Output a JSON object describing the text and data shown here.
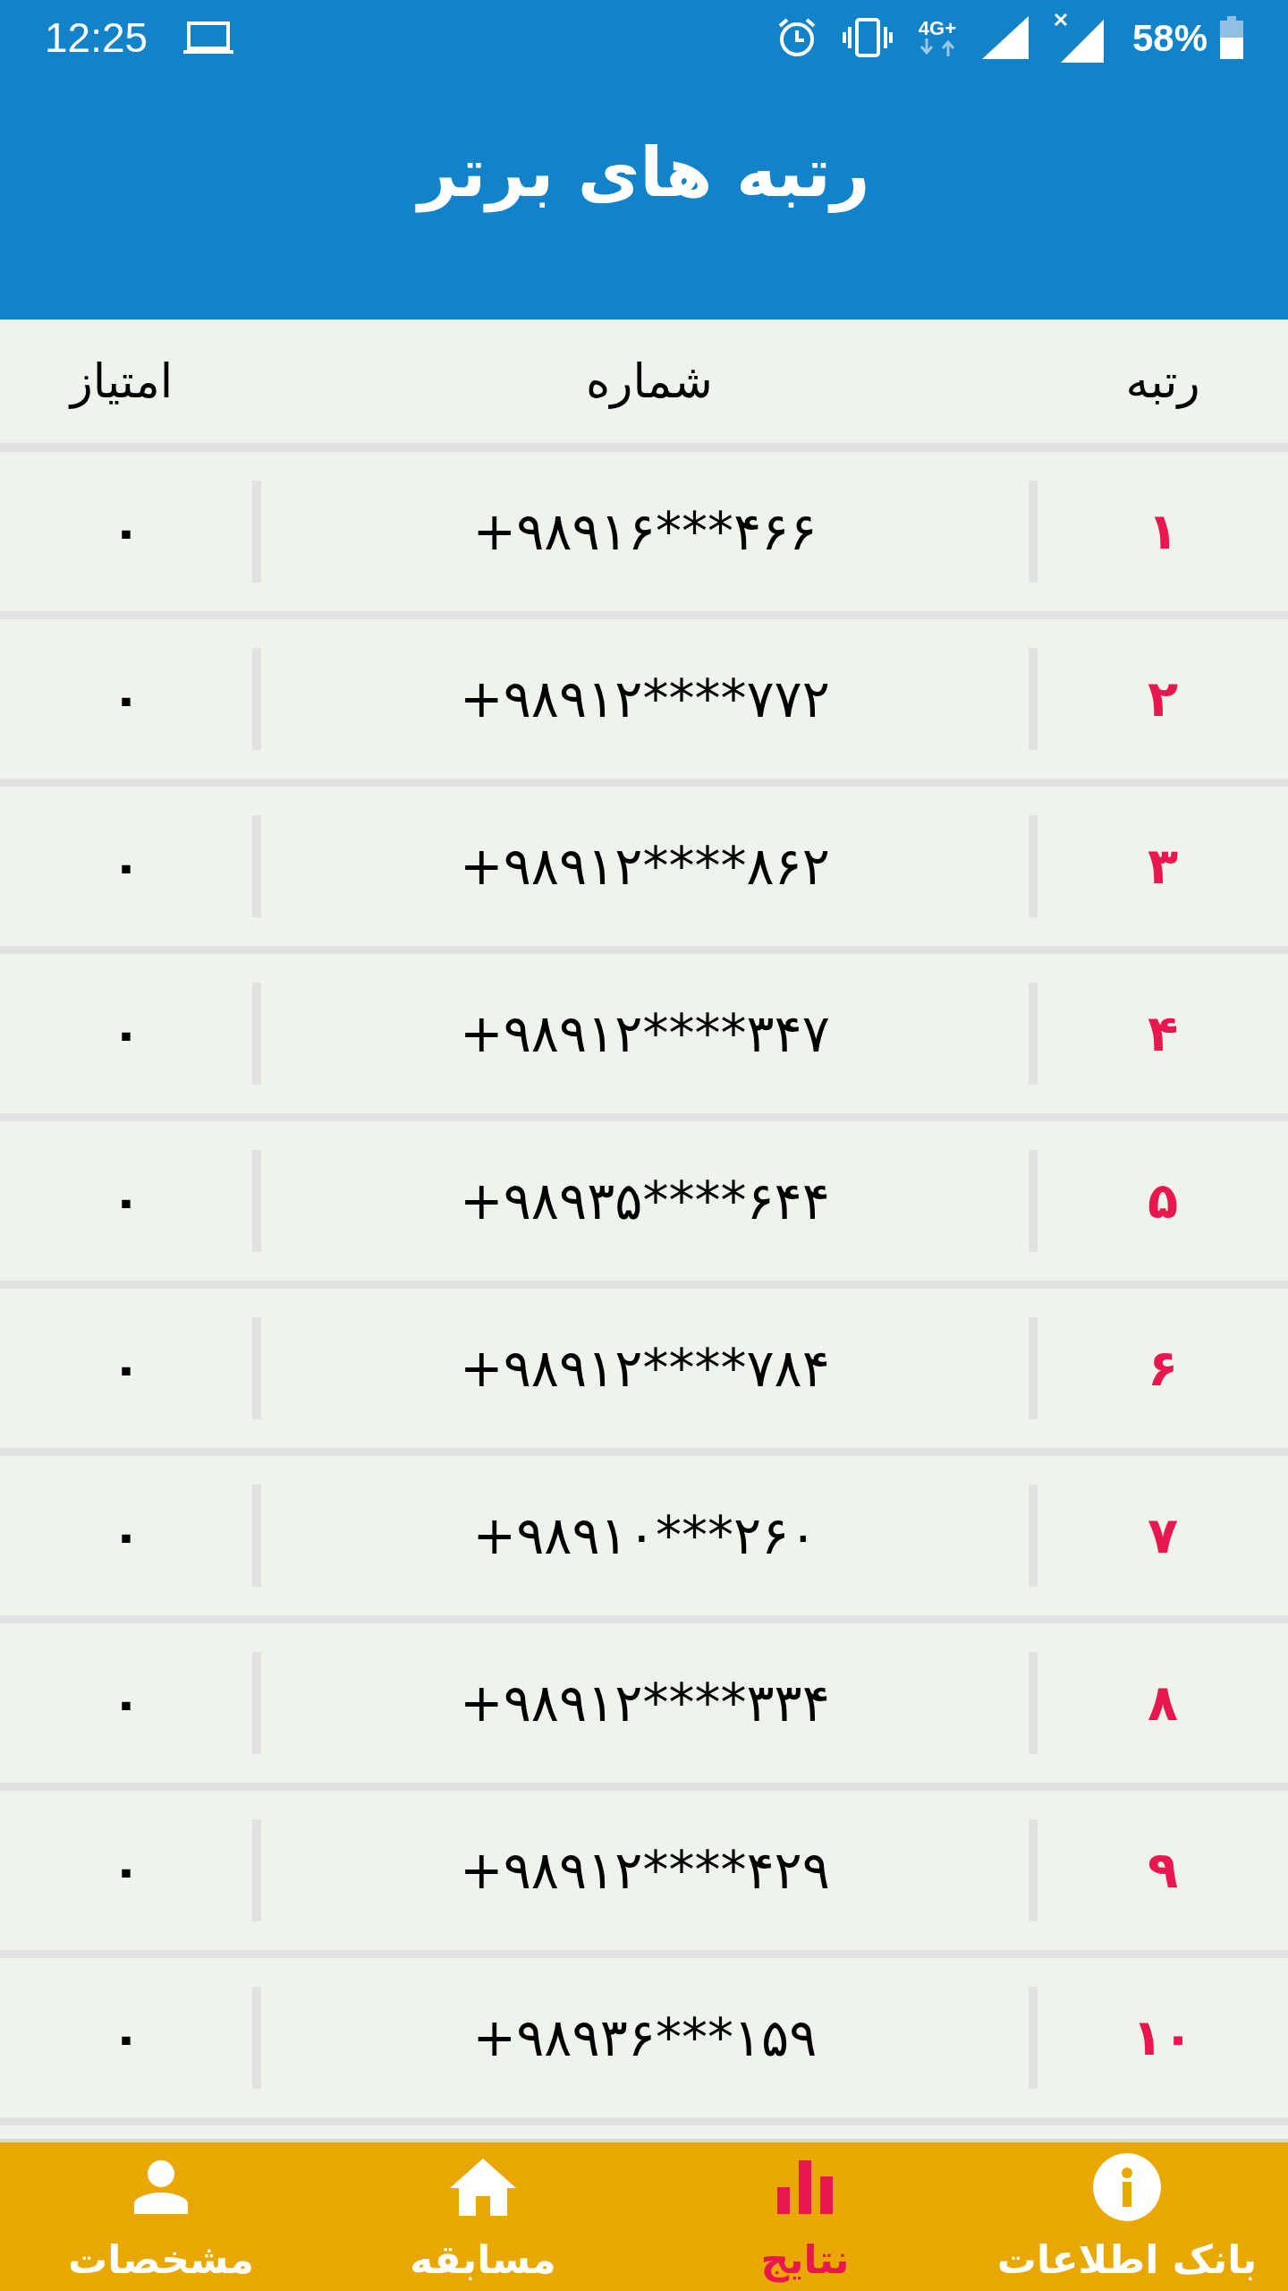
{
  "status_bar": {
    "time": "12:25",
    "network": "4G+",
    "battery": "58%"
  },
  "header": {
    "title": "رتبه های برتر"
  },
  "table": {
    "columns": [
      "رتبه",
      "شماره",
      "امتیاز"
    ],
    "rows": [
      {
        "rank": "۱",
        "number": "+۹۸۹۱۶***۴۶۶",
        "score": "۰"
      },
      {
        "rank": "۲",
        "number": "+۹۸۹۱۲****۷۷۲",
        "score": "۰"
      },
      {
        "rank": "۳",
        "number": "+۹۸۹۱۲****۸۶۲",
        "score": "۰"
      },
      {
        "rank": "۴",
        "number": "+۹۸۹۱۲****۳۴۷",
        "score": "۰"
      },
      {
        "rank": "۵",
        "number": "+۹۸۹۳۵****۶۴۴",
        "score": "۰"
      },
      {
        "rank": "۶",
        "number": "+۹۸۹۱۲****۷۸۴",
        "score": "۰"
      },
      {
        "rank": "۷",
        "number": "+۹۸۹۱۰***۲۶۰",
        "score": "۰"
      },
      {
        "rank": "۸",
        "number": "+۹۸۹۱۲****۳۳۴",
        "score": "۰"
      },
      {
        "rank": "۹",
        "number": "+۹۸۹۱۲****۴۲۹",
        "score": "۰"
      },
      {
        "rank": "۱۰",
        "number": "+۹۸۹۳۶***۱۵۹",
        "score": "۰"
      }
    ]
  },
  "bottom_nav": [
    {
      "kind": "info",
      "label": "بانک اطلاعات",
      "selected": false
    },
    {
      "kind": "results",
      "label": "نتایج",
      "selected": true
    },
    {
      "kind": "contest",
      "label": "مسابقه",
      "selected": false
    },
    {
      "kind": "profile",
      "label": "مشخصات",
      "selected": false
    }
  ]
}
